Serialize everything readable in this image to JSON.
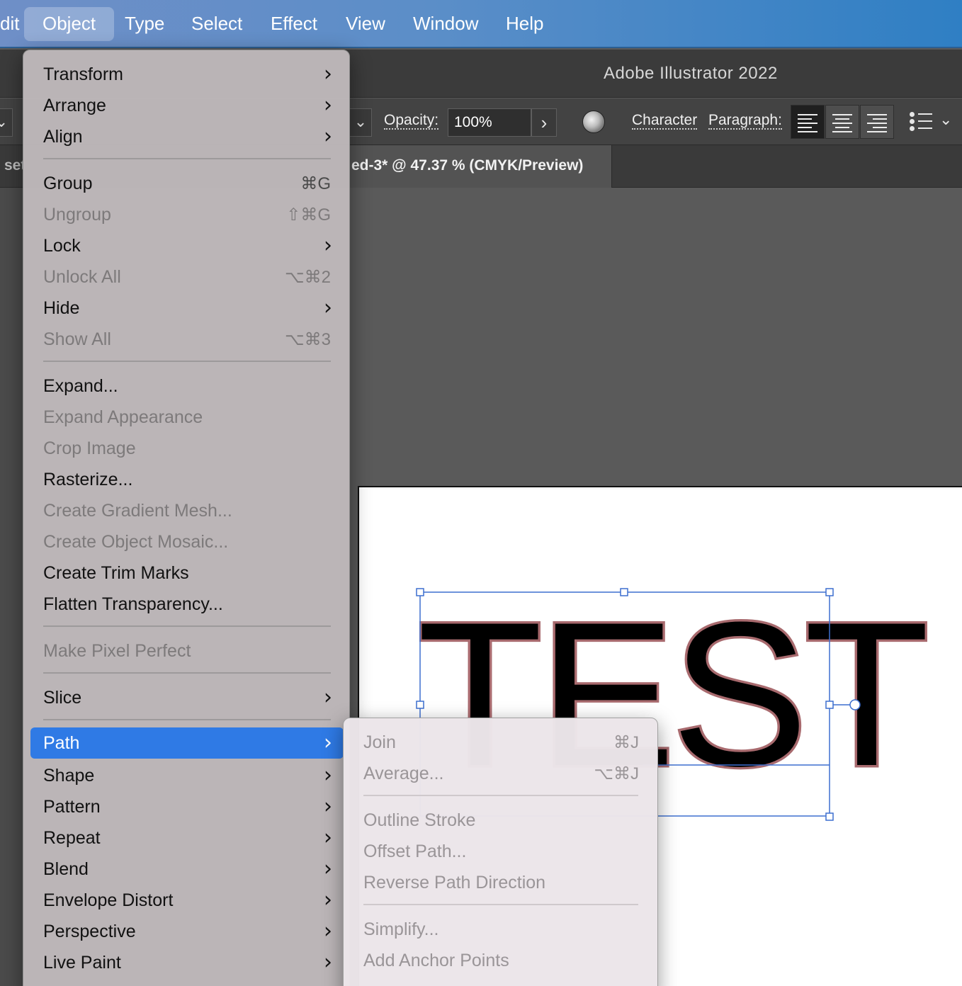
{
  "menubar": {
    "items": [
      {
        "label": "dit"
      },
      {
        "label": "Object"
      },
      {
        "label": "Type"
      },
      {
        "label": "Select"
      },
      {
        "label": "Effect"
      },
      {
        "label": "View"
      },
      {
        "label": "Window"
      },
      {
        "label": "Help"
      }
    ]
  },
  "app": {
    "title": "Adobe Illustrator 2022"
  },
  "controlbar": {
    "opacity_label": "Opacity:",
    "opacity_value": "100%",
    "character_label": "Character",
    "paragraph_label": "Paragraph:"
  },
  "document": {
    "tab_title": "ed-3* @ 47.37 % (CMYK/Preview)",
    "left_tab_fragment": "set",
    "artwork_text": "TEST"
  },
  "object_menu": {
    "items": [
      {
        "label": "Transform",
        "shortcut": "",
        "submenu": true,
        "disabled": false
      },
      {
        "label": "Arrange",
        "shortcut": "",
        "submenu": true,
        "disabled": false
      },
      {
        "label": "Align",
        "shortcut": "",
        "submenu": true,
        "disabled": false
      },
      {
        "label": "Group",
        "shortcut": "⌘G",
        "submenu": false,
        "disabled": false
      },
      {
        "label": "Ungroup",
        "shortcut": "⇧⌘G",
        "submenu": false,
        "disabled": true
      },
      {
        "label": "Lock",
        "shortcut": "",
        "submenu": true,
        "disabled": false
      },
      {
        "label": "Unlock All",
        "shortcut": "⌥⌘2",
        "submenu": false,
        "disabled": true
      },
      {
        "label": "Hide",
        "shortcut": "",
        "submenu": true,
        "disabled": false
      },
      {
        "label": "Show All",
        "shortcut": "⌥⌘3",
        "submenu": false,
        "disabled": true
      },
      {
        "label": "Expand...",
        "shortcut": "",
        "submenu": false,
        "disabled": false
      },
      {
        "label": "Expand Appearance",
        "shortcut": "",
        "submenu": false,
        "disabled": true
      },
      {
        "label": "Crop Image",
        "shortcut": "",
        "submenu": false,
        "disabled": true
      },
      {
        "label": "Rasterize...",
        "shortcut": "",
        "submenu": false,
        "disabled": false
      },
      {
        "label": "Create Gradient Mesh...",
        "shortcut": "",
        "submenu": false,
        "disabled": true
      },
      {
        "label": "Create Object Mosaic...",
        "shortcut": "",
        "submenu": false,
        "disabled": true
      },
      {
        "label": "Create Trim Marks",
        "shortcut": "",
        "submenu": false,
        "disabled": false
      },
      {
        "label": "Flatten Transparency...",
        "shortcut": "",
        "submenu": false,
        "disabled": false
      },
      {
        "label": "Make Pixel Perfect",
        "shortcut": "",
        "submenu": false,
        "disabled": true
      },
      {
        "label": "Slice",
        "shortcut": "",
        "submenu": true,
        "disabled": false
      },
      {
        "label": "Path",
        "shortcut": "",
        "submenu": true,
        "disabled": false,
        "highlighted": true
      },
      {
        "label": "Shape",
        "shortcut": "",
        "submenu": true,
        "disabled": false
      },
      {
        "label": "Pattern",
        "shortcut": "",
        "submenu": true,
        "disabled": false
      },
      {
        "label": "Repeat",
        "shortcut": "",
        "submenu": true,
        "disabled": false
      },
      {
        "label": "Blend",
        "shortcut": "",
        "submenu": true,
        "disabled": false
      },
      {
        "label": "Envelope Distort",
        "shortcut": "",
        "submenu": true,
        "disabled": false
      },
      {
        "label": "Perspective",
        "shortcut": "",
        "submenu": true,
        "disabled": false
      },
      {
        "label": "Live Paint",
        "shortcut": "",
        "submenu": true,
        "disabled": false
      }
    ]
  },
  "path_submenu": {
    "items": [
      {
        "label": "Join",
        "shortcut": "⌘J",
        "disabled": true
      },
      {
        "label": "Average...",
        "shortcut": "⌥⌘J",
        "disabled": true
      },
      {
        "label": "Outline Stroke",
        "shortcut": "",
        "disabled": true
      },
      {
        "label": "Offset Path...",
        "shortcut": "",
        "disabled": true
      },
      {
        "label": "Reverse Path Direction",
        "shortcut": "",
        "disabled": true
      },
      {
        "label": "Simplify...",
        "shortcut": "",
        "disabled": true
      },
      {
        "label": "Add Anchor Points",
        "shortcut": "",
        "disabled": true
      }
    ]
  },
  "colors": {
    "menubar_accent": "#2f7fc4",
    "menu_highlight": "#2f7ae5",
    "text_stroke": "#a86a6e",
    "selection": "#3d6fcf"
  }
}
